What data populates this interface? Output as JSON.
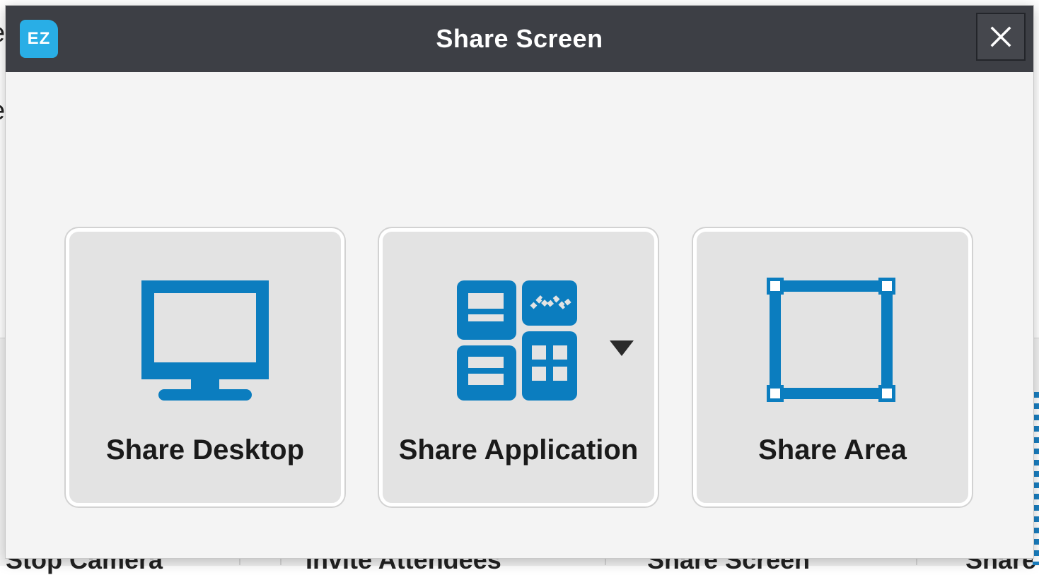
{
  "dialog": {
    "title": "Share Screen",
    "logo_text": "EZ",
    "close_icon": "close-icon"
  },
  "options": [
    {
      "label": "Share Desktop",
      "icon": "monitor-icon"
    },
    {
      "label": "Share Application",
      "icon": "application-grid-icon",
      "has_dropdown": true
    },
    {
      "label": "Share Area",
      "icon": "area-selection-icon"
    }
  ],
  "background": {
    "side_glyph_1": "e",
    "side_glyph_2": "e",
    "toolbar_items": [
      "Stop Camera",
      "Invite Attendees",
      "Share Screen",
      "Share"
    ]
  },
  "colors": {
    "titlebar": "#3d3f45",
    "accent": "#0b7dbf",
    "logo": "#29aee6",
    "tile_bg": "#e3e3e3",
    "dialog_bg": "#f4f4f4"
  }
}
